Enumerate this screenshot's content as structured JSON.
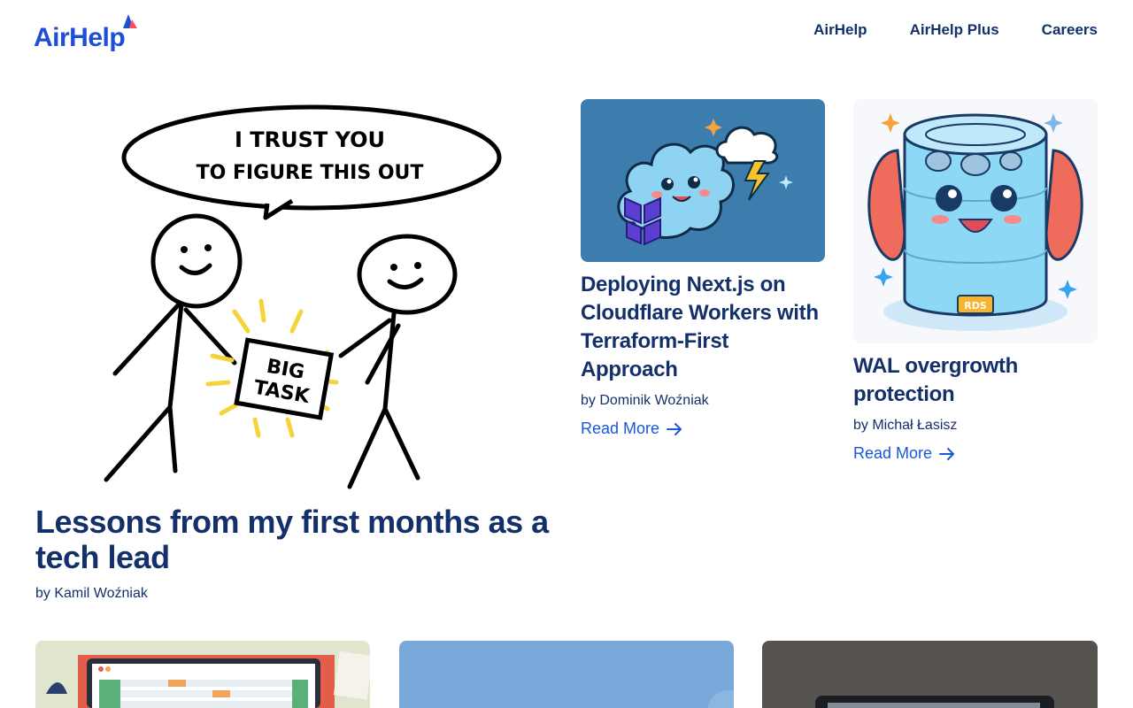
{
  "header": {
    "logo_text": "AirHelp",
    "nav": [
      "AirHelp",
      "AirHelp Plus",
      "Careers"
    ]
  },
  "featured": {
    "image_text": {
      "bubble_line1": "I TRUST YOU",
      "bubble_line2": "TO FIGURE THIS OUT",
      "box_line1": "BIG",
      "box_line2": "TASK"
    },
    "title": "Lessons from my first months as a tech lead",
    "author": "by Kamil Woźniak"
  },
  "cards": [
    {
      "title": "Deploying Next.js on Cloudflare Workers with Terraform-First Approach",
      "author": "by Dominik Woźniak",
      "read_more": "Read More"
    },
    {
      "title": "WAL overgrowth protection",
      "author": "by Michał Łasisz",
      "read_more": "Read More",
      "image_label": "RDS"
    }
  ],
  "colors": {
    "navy": "#14306b",
    "link_blue": "#1d55d9",
    "logo_blue": "#1c4fd6",
    "logo_red": "#ff4f5e"
  }
}
